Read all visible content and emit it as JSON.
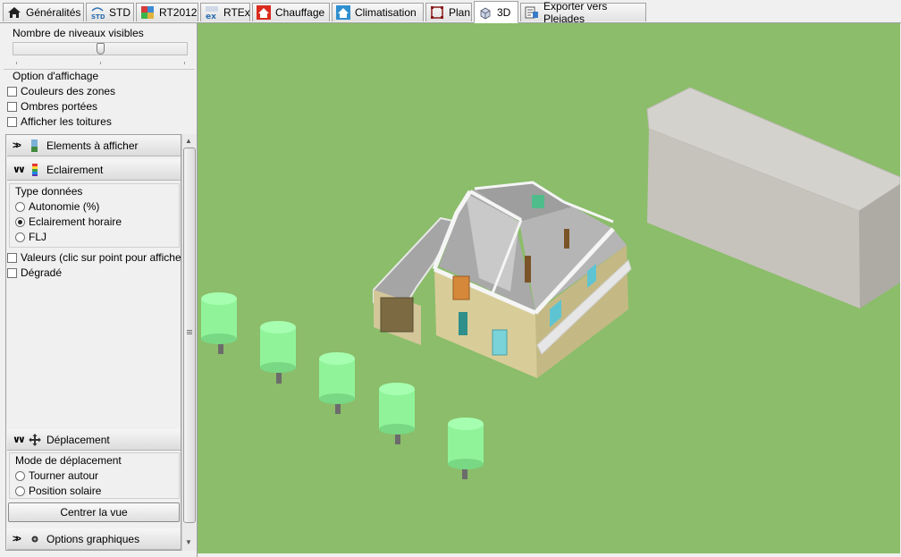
{
  "tabs": [
    {
      "label": "Généralités",
      "icon": "home-icon"
    },
    {
      "label": "STD",
      "icon": "std-icon"
    },
    {
      "label": "RT2012",
      "icon": "rt2012-icon"
    },
    {
      "label": "RTEx",
      "icon": "rtex-icon"
    },
    {
      "label": "Chauffage",
      "icon": "heating-house-icon"
    },
    {
      "label": "Climatisation",
      "icon": "cooling-house-icon"
    },
    {
      "label": "Plan",
      "icon": "plan-icon"
    },
    {
      "label": "3D",
      "icon": "3d-icon",
      "active": true
    },
    {
      "label": "Exporter vers Pleiades",
      "icon": "export-icon"
    }
  ],
  "levels": {
    "title": "Nombre de niveaux visibles"
  },
  "display_options": {
    "title": "Option d'affichage",
    "items": [
      {
        "label": "Couleurs des zones",
        "checked": false
      },
      {
        "label": "Ombres portées",
        "checked": false
      },
      {
        "label": "Afficher les toitures",
        "checked": false
      }
    ]
  },
  "sections": {
    "elements": {
      "label": "Elements à afficher",
      "expanded": false
    },
    "lighting": {
      "label": "Eclairement",
      "expanded": true,
      "type_title": "Type données",
      "types": [
        {
          "label": "Autonomie (%)",
          "selected": false
        },
        {
          "label": "Eclairement horaire",
          "selected": true
        },
        {
          "label": "FLJ",
          "selected": false
        }
      ],
      "values_label": "Valeurs (clic sur point pour afficher)",
      "gradient_label": "Dégradé"
    },
    "movement": {
      "label": "Déplacement",
      "expanded": true,
      "mode_title": "Mode de déplacement",
      "modes": [
        {
          "label": "Tourner autour",
          "selected": false
        },
        {
          "label": "Position solaire",
          "selected": false
        }
      ],
      "center_button": "Centrer la vue"
    },
    "graphics": {
      "label": "Options graphiques",
      "expanded": false
    }
  },
  "colors": {
    "ground": "#8bbd6a",
    "tree": "#90f39a",
    "wall": "#d9cf9c"
  }
}
